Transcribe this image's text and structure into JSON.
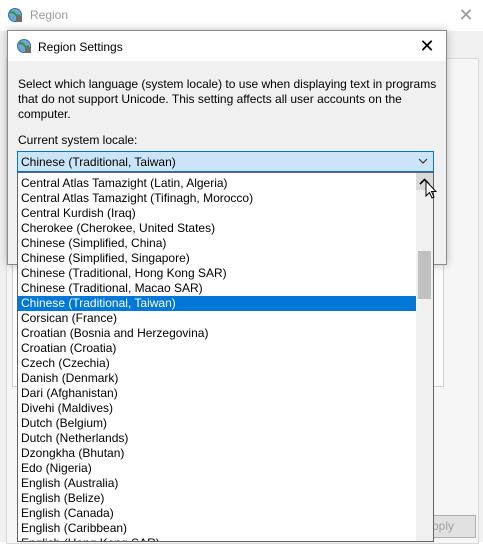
{
  "background_window": {
    "title": "Region",
    "apply_label": "Apply"
  },
  "dialog": {
    "title": "Region Settings",
    "description": "Select which language (system locale) to use when displaying text in programs that do not support Unicode. This setting affects all user accounts on the computer.",
    "current_locale_label": "Current system locale:",
    "current_locale_value": "Chinese (Traditional, Taiwan)"
  },
  "locale_list": {
    "selected": "Chinese (Traditional, Taiwan)",
    "items": [
      "Central Atlas Tamazight (Latin, Algeria)",
      "Central Atlas Tamazight (Tifinagh, Morocco)",
      "Central Kurdish (Iraq)",
      "Cherokee (Cherokee, United States)",
      "Chinese (Simplified, China)",
      "Chinese (Simplified, Singapore)",
      "Chinese (Traditional, Hong Kong SAR)",
      "Chinese (Traditional, Macao SAR)",
      "Chinese (Traditional, Taiwan)",
      "Corsican (France)",
      "Croatian (Bosnia and Herzegovina)",
      "Croatian (Croatia)",
      "Czech (Czechia)",
      "Danish (Denmark)",
      "Dari (Afghanistan)",
      "Divehi (Maldives)",
      "Dutch (Belgium)",
      "Dutch (Netherlands)",
      "Dzongkha (Bhutan)",
      "Edo (Nigeria)",
      "English (Australia)",
      "English (Belize)",
      "English (Canada)",
      "English (Caribbean)",
      "English (Hong Kong SAR)"
    ]
  },
  "colors": {
    "selection": "#0078d7",
    "combo_background": "#cce4f7"
  },
  "icons": {
    "window_icon": "globe-region-icon",
    "close": "close-icon",
    "dropdown_arrow": "chevron-down-icon",
    "scroll_up": "chevron-up-icon",
    "pointer": "mouse-cursor-icon"
  }
}
